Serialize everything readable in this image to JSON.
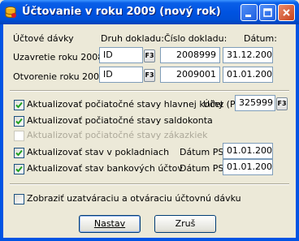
{
  "window": {
    "title": "Účtovanie v roku 2009 (nový rok)"
  },
  "headers": {
    "row_label": "Účtové dávky",
    "druh": "Druh dokladu:",
    "cislo": "Číslo dokladu:",
    "datum": "Dátum:"
  },
  "rows": [
    {
      "label": "Uzavretie roku 2008:",
      "druh": "ID",
      "f3": "F3",
      "cislo": "2008999",
      "datum": "31.12.2008"
    },
    {
      "label": "Otvorenie roku 2009:",
      "druh": "ID",
      "f3": "F3",
      "cislo": "2009001",
      "datum": "01.01.2009"
    }
  ],
  "options": [
    {
      "label": "Aktualizovať počiatočné stavy hlavnej knihy",
      "checked": true,
      "enabled": true
    },
    {
      "label": "Aktualizovať počiatočné stavy saldokonta",
      "checked": true,
      "enabled": true
    },
    {
      "label": "Aktualizovať počiatočné stavy zákazkiek",
      "checked": false,
      "enabled": false
    },
    {
      "label": "Aktualizovať stav v pokladniach",
      "checked": true,
      "enabled": true
    },
    {
      "label": "Aktualizovať stav bankových účtov",
      "checked": true,
      "enabled": true
    }
  ],
  "ucet": {
    "label": "Účet (P):",
    "value": "325999",
    "f3": "F3"
  },
  "datum_ps": [
    {
      "label": "Dátum PS:",
      "value": "01.01.2009"
    },
    {
      "label": "Dátum PS:",
      "value": "01.01.2009"
    }
  ],
  "show_batch": {
    "label": "Zobraziť uzatváraciu a otváraciu účtovnú dávku",
    "checked": false
  },
  "buttons": {
    "ok_label": "Nastav",
    "cancel_label": "Zruš"
  }
}
